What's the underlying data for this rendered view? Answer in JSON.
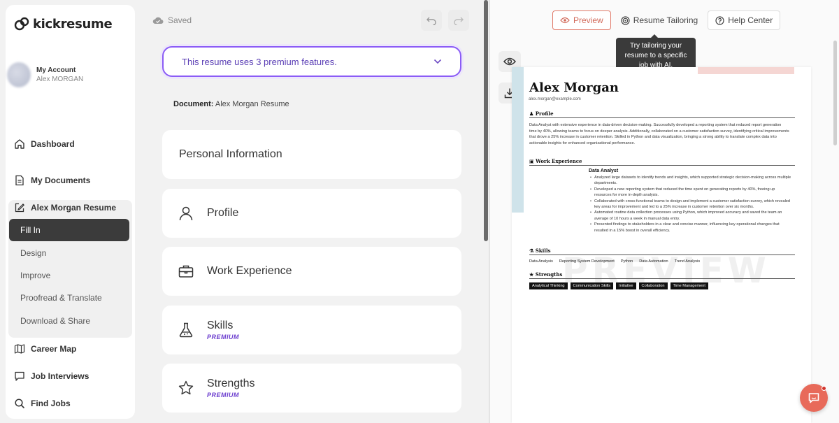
{
  "app": {
    "name": "kickresume"
  },
  "account": {
    "title": "My Account",
    "name": "Alex MORGAN"
  },
  "nav": {
    "dashboard": "Dashboard",
    "documents": "My Documents",
    "resume": "Alex Morgan Resume",
    "sub": [
      "Fill In",
      "Design",
      "Improve",
      "Proofread & Translate",
      "Download & Share"
    ],
    "career_map": "Career Map",
    "job_interviews": "Job Interviews",
    "find_jobs": "Find Jobs"
  },
  "editor": {
    "saved": "Saved",
    "premium_banner": "This resume uses 3 premium features.",
    "document_label": "Document:",
    "document_name": "Alex Morgan Resume",
    "sections": [
      {
        "title": "Personal Information",
        "badge": ""
      },
      {
        "title": "Profile",
        "badge": ""
      },
      {
        "title": "Work Experience",
        "badge": ""
      },
      {
        "title": "Skills",
        "badge": "PREMIUM"
      },
      {
        "title": "Strengths",
        "badge": "PREMIUM"
      }
    ]
  },
  "preview_tabs": {
    "preview": "Preview",
    "tailoring": "Resume Tailoring",
    "help": "Help Center"
  },
  "tooltip": {
    "line1": "Try tailoring your",
    "line2": "resume to a specific",
    "line3": "job with AI."
  },
  "resume": {
    "name": "Alex Morgan",
    "email": "alex.morgan@example.com",
    "profile_heading": "Profile",
    "profile_text": "Data Analyst with extensive experience in data-driven decision-making. Successfully developed a reporting system that reduced report generation time by 40%, allowing teams to focus on deeper analysis. Additionally, collaborated on a customer satisfaction survey, identifying critical improvements that drove a 25% increase in customer retention. Skilled in Python and data visualization, bringing a strong ability to translate complex data into actionable insights for enhanced organizational performance.",
    "work_heading": "Work Experience",
    "job_title": "Data Analyst",
    "bullets": [
      "Analyzed large datasets to identify trends and insights, which supported strategic decision-making across multiple departments.",
      "Developed a new reporting system that reduced the time spent on generating reports by 40%, freeing up resources for more in-depth analysis.",
      "Collaborated with cross-functional teams to design and implement a customer satisfaction survey, which revealed key areas for improvement and led to a 25% increase in customer retention over six months.",
      "Automated routine data collection processes using Python, which improved accuracy and saved the team an average of 10 hours a week in manual data entry.",
      "Presented findings to stakeholders in a clear and concise manner, influencing key operational changes that resulted in a 15% boost in overall efficiency."
    ],
    "skills_heading": "Skills",
    "skills": [
      "Data Analysis",
      "Reporting System Development",
      "Python",
      "Data Automation",
      "Trend Analysis"
    ],
    "strengths_heading": "Strengths",
    "strengths": [
      "Analytical Thinking",
      "Communication Skills",
      "Initiative",
      "Collaboration",
      "Time Management"
    ],
    "watermark": "PREVIEW"
  }
}
